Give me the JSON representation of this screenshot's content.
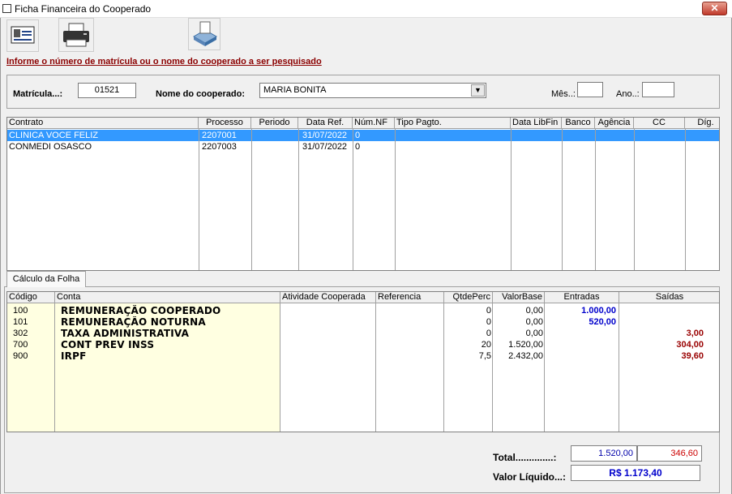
{
  "window": {
    "title": "Ficha Financeira do Cooperado",
    "close_label": "✕"
  },
  "toolbar": {
    "icons": [
      "id-card-icon",
      "printer-icon",
      "print-preview-icon"
    ]
  },
  "instruction": "Informe o número de matrícula ou o nome do cooperado a ser pesquisado",
  "search": {
    "matricula_label": "Matrícula...:",
    "matricula_value": "01521",
    "nome_label": "Nome do cooperado:",
    "nome_value": "MARIA BONITA",
    "mes_label": "Mês..:",
    "mes_value": "",
    "ano_label": "Ano..:",
    "ano_value": ""
  },
  "contracts": {
    "headers": [
      "Contrato",
      "Processo",
      "Periodo",
      "Data Ref.",
      "Núm.NF",
      "Tipo Pagto.",
      "Data LibFin",
      "Banco",
      "Agência",
      "CC",
      "Díg."
    ],
    "rows": [
      {
        "contrato": "CLINICA VOCE FELIZ",
        "processo": "2207001",
        "periodo": "",
        "data_ref": "31/07/2022",
        "num_nf": "0",
        "selected": true
      },
      {
        "contrato": "CONMEDI OSASCO",
        "processo": "2207003",
        "periodo": "",
        "data_ref": "31/07/2022",
        "num_nf": "0",
        "selected": false
      }
    ]
  },
  "tab": {
    "label": "Cálculo da Folha"
  },
  "folha": {
    "headers": [
      "Código",
      "Conta",
      "Atividade Cooperada",
      "Referencia",
      "QtdePerc",
      "ValorBase",
      "Entradas",
      "Saídas"
    ],
    "rows": [
      {
        "codigo": "100",
        "conta": "REMUNERAÇÃO COOPERADO",
        "qtde": "0",
        "valorbase": "0,00",
        "entradas": "1.000,00",
        "saidas": ""
      },
      {
        "codigo": "101",
        "conta": "REMUNERAÇÃO NOTURNA",
        "qtde": "0",
        "valorbase": "0,00",
        "entradas": "520,00",
        "saidas": ""
      },
      {
        "codigo": "302",
        "conta": "TAXA ADMINISTRATIVA",
        "qtde": "0",
        "valorbase": "0,00",
        "entradas": "",
        "saidas": "3,00"
      },
      {
        "codigo": "700",
        "conta": "CONT PREV INSS",
        "qtde": "20",
        "valorbase": "1.520,00",
        "entradas": "",
        "saidas": "304,00"
      },
      {
        "codigo": "900",
        "conta": "IRPF",
        "qtde": "7,5",
        "valorbase": "2.432,00",
        "entradas": "",
        "saidas": "39,60"
      }
    ]
  },
  "totals": {
    "total_label": "Total..............:",
    "total_entradas": "1.520,00",
    "total_saidas": "346,60",
    "liquido_label": "Valor Líquido...:",
    "liquido_value": "R$ 1.173,40"
  },
  "colors": {
    "selection": "#3399ff",
    "link": "#8b0000",
    "entradas": "#0000cc",
    "saidas": "#990000",
    "code_bg": "#ffffe1"
  }
}
